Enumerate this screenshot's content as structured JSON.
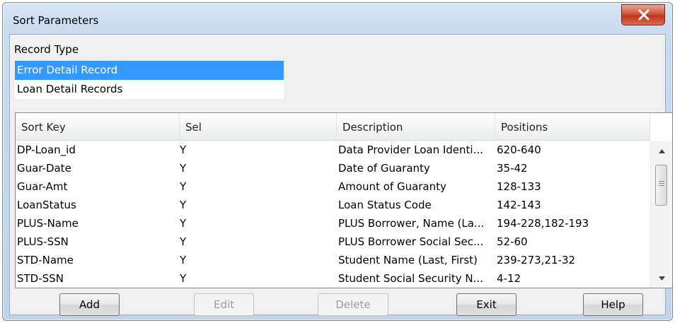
{
  "window": {
    "title": "Sort Parameters",
    "close_symbol": "X"
  },
  "record_type": {
    "label": "Record Type",
    "items": [
      {
        "label": "Error Detail Record",
        "selected": true
      },
      {
        "label": "Loan Detail Records",
        "selected": false
      }
    ]
  },
  "table": {
    "columns": [
      "Sort Key",
      "Sel",
      "Description",
      "Positions"
    ],
    "rows": [
      {
        "sort_key": "DP-Loan_id",
        "sel": "Y",
        "description": "Data Provider Loan Identi...",
        "positions": "620-640"
      },
      {
        "sort_key": "Guar-Date",
        "sel": "Y",
        "description": "Date of Guaranty",
        "positions": "35-42"
      },
      {
        "sort_key": "Guar-Amt",
        "sel": "Y",
        "description": "Amount of Guaranty",
        "positions": "128-133"
      },
      {
        "sort_key": "LoanStatus",
        "sel": "Y",
        "description": "Loan Status Code",
        "positions": "142-143"
      },
      {
        "sort_key": "PLUS-Name",
        "sel": "Y",
        "description": "PLUS Borrower, Name (La...",
        "positions": "194-228,182-193"
      },
      {
        "sort_key": "PLUS-SSN",
        "sel": "Y",
        "description": "PLUS Borrower Social Sec...",
        "positions": "52-60"
      },
      {
        "sort_key": "STD-Name",
        "sel": "Y",
        "description": "Student Name (Last, First)",
        "positions": "239-273,21-32"
      },
      {
        "sort_key": "STD-SSN",
        "sel": "Y",
        "description": "Student Social Security N...",
        "positions": "4-12"
      }
    ]
  },
  "buttons": {
    "add": "Add",
    "edit": "Edit",
    "delete": "Delete",
    "exit": "Exit",
    "help": "Help"
  },
  "colors": {
    "selection": "#3399ff",
    "close_button": "#c0351c"
  }
}
